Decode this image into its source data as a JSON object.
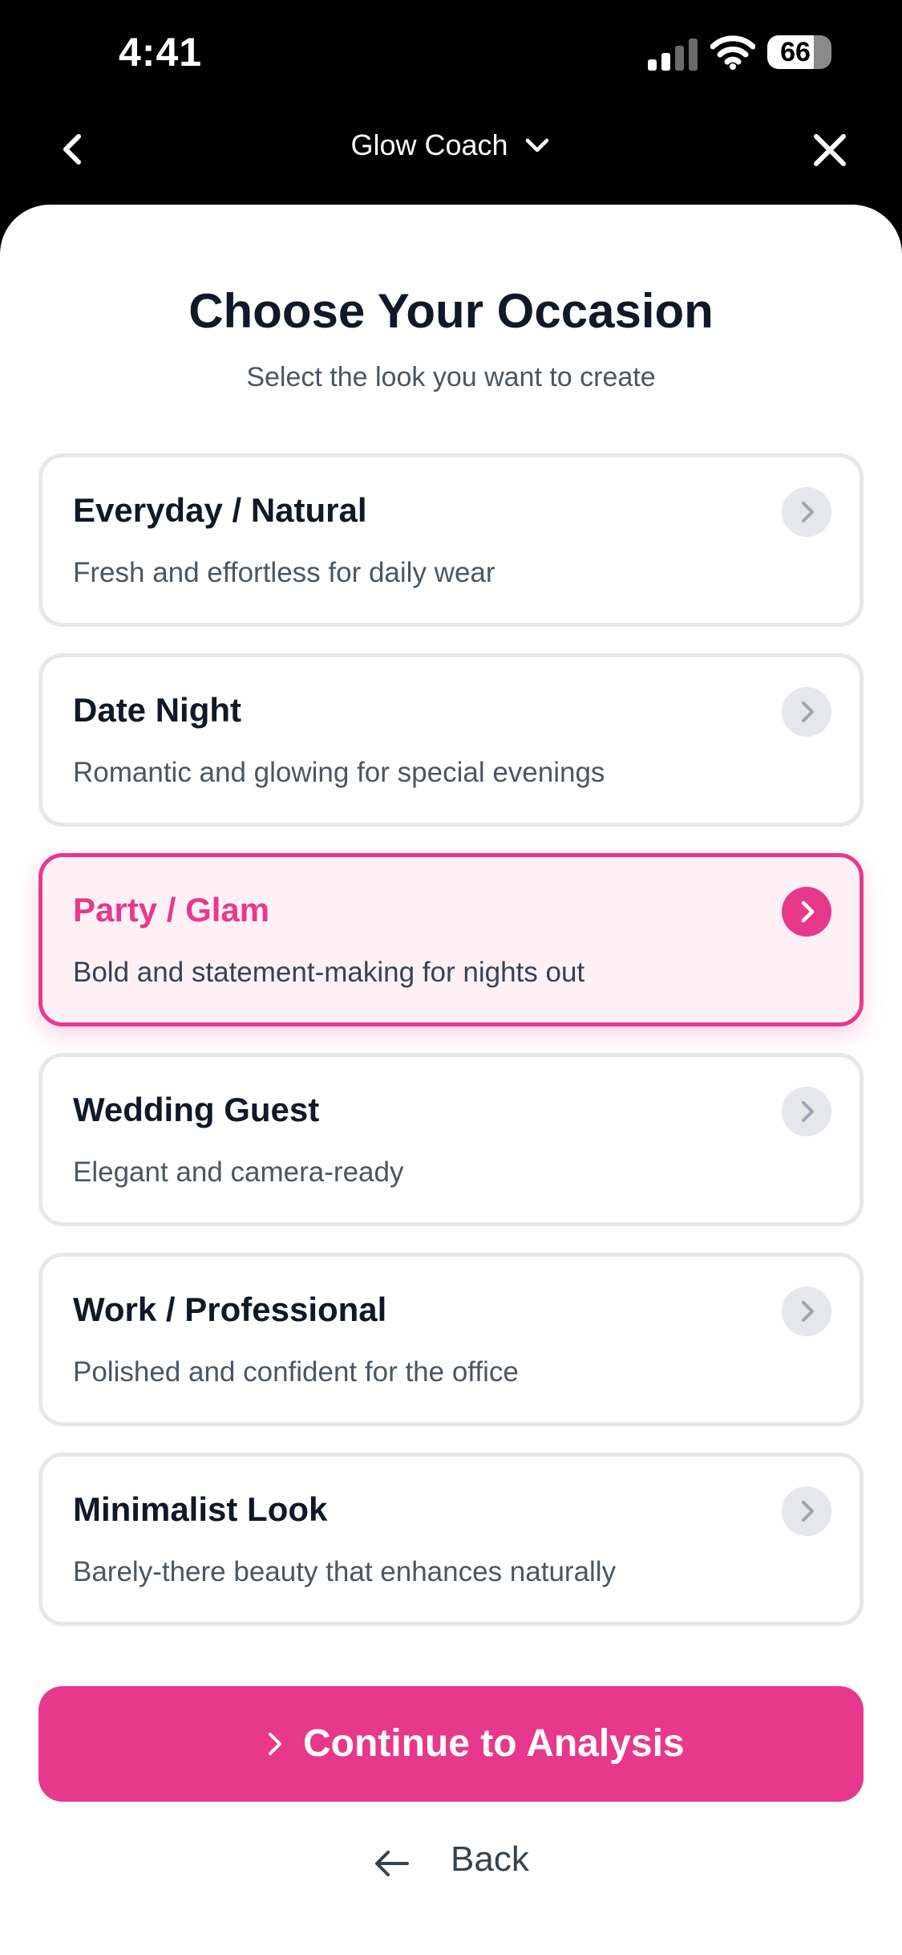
{
  "status_bar": {
    "time": "4:41",
    "battery": "66"
  },
  "nav": {
    "title": "Glow Coach"
  },
  "page": {
    "title": "Choose Your Occasion",
    "subtitle": "Select the look you want to create"
  },
  "options": [
    {
      "title": "Everyday / Natural",
      "description": "Fresh and effortless for daily wear",
      "selected": false
    },
    {
      "title": "Date Night",
      "description": "Romantic and glowing for special evenings",
      "selected": false
    },
    {
      "title": "Party / Glam",
      "description": "Bold and statement-making for nights out",
      "selected": true
    },
    {
      "title": "Wedding Guest",
      "description": "Elegant and camera-ready",
      "selected": false
    },
    {
      "title": "Work / Professional",
      "description": "Polished and confident for the office",
      "selected": false
    },
    {
      "title": "Minimalist Look",
      "description": "Barely-there beauty that enhances naturally",
      "selected": false
    }
  ],
  "actions": {
    "continue_label": "Continue to Analysis",
    "back_label": "Back"
  },
  "colors": {
    "accent": "#e8388c",
    "selected_background": "#fdf1f6",
    "text_primary": "#111827",
    "text_secondary": "#4b5563"
  }
}
